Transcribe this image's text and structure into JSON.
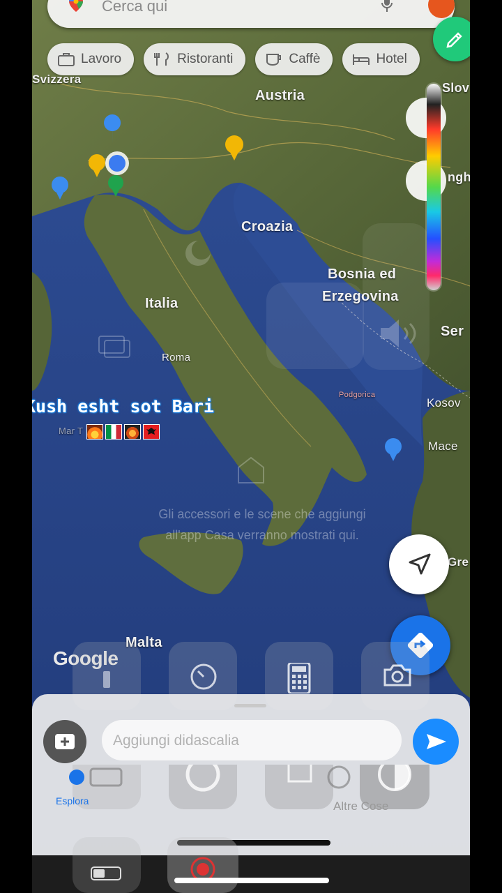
{
  "search": {
    "placeholder": "Cerca qui"
  },
  "chips": [
    {
      "label": "Lavoro",
      "icon": "briefcase-icon"
    },
    {
      "label": "Ristoranti",
      "icon": "fork-knife-icon"
    },
    {
      "label": "Caffè",
      "icon": "coffee-cup-icon"
    },
    {
      "label": "Hotel",
      "icon": "bed-icon"
    }
  ],
  "map_labels": {
    "svizzera": "Svizzera",
    "austria": "Austria",
    "croazia": "Croazia",
    "bosnia_1": "Bosnia ed",
    "bosnia_2": "Erzegovina",
    "italia": "Italia",
    "roma": "Roma",
    "serbia": "Ser",
    "kosovo": "Kosov",
    "mace": "Mace",
    "mar": "Mar T",
    "malta": "Malta",
    "gre": "Gre",
    "slov": "Slov",
    "podgorica": "Podgorica",
    "ungh": "ngh"
  },
  "caption": {
    "text": "Kush esht sot Bari"
  },
  "overlay": {
    "line1": "Gli accessori e le scene che aggiungi",
    "line2": "all'app Casa verranno mostrati qui."
  },
  "google_logo": "Google",
  "caption_input": {
    "placeholder": "Aggiungi didascalia"
  },
  "tabs": {
    "explore": "Esplora",
    "next": "Altre Cose"
  },
  "colors": {
    "accent": "#1a73e8",
    "green": "#20c97a",
    "caption_outline": "#1a7bd8"
  }
}
